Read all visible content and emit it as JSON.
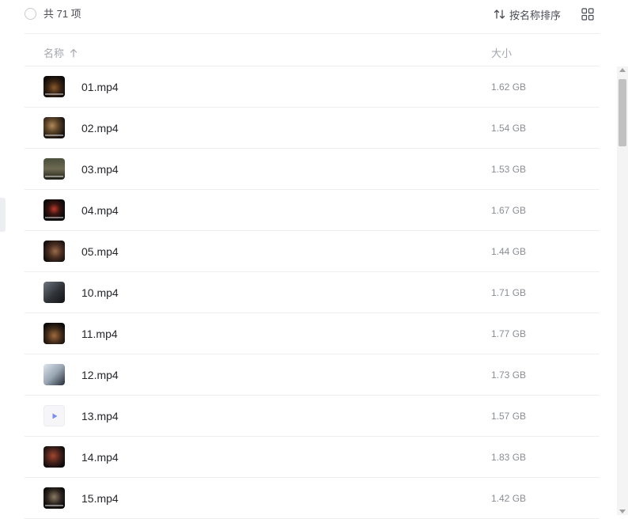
{
  "toolbar": {
    "count_label": "共 71 项",
    "sort_label": "按名称排序",
    "icons": {
      "select_all": "circle-checkbox-icon",
      "sort": "sort-arrows-icon",
      "view": "grid-view-icon"
    }
  },
  "table": {
    "headers": {
      "name": "名称",
      "size": "大小"
    },
    "sort_indicator": "arrow-up-icon",
    "rows": [
      {
        "name": "01.mp4",
        "size": "1.62 GB"
      },
      {
        "name": "02.mp4",
        "size": "1.54 GB"
      },
      {
        "name": "03.mp4",
        "size": "1.53 GB"
      },
      {
        "name": "04.mp4",
        "size": "1.67 GB"
      },
      {
        "name": "05.mp4",
        "size": "1.44 GB"
      },
      {
        "name": "10.mp4",
        "size": "1.71 GB"
      },
      {
        "name": "11.mp4",
        "size": "1.77 GB"
      },
      {
        "name": "12.mp4",
        "size": "1.73 GB"
      },
      {
        "name": "13.mp4",
        "size": "1.57 GB"
      },
      {
        "name": "14.mp4",
        "size": "1.83 GB"
      },
      {
        "name": "15.mp4",
        "size": "1.42 GB"
      }
    ]
  },
  "colors": {
    "text_primary": "#25262b",
    "text_secondary": "#8a8d95",
    "divider": "#eceef2",
    "video_play_icon": "#7b8cf5"
  }
}
